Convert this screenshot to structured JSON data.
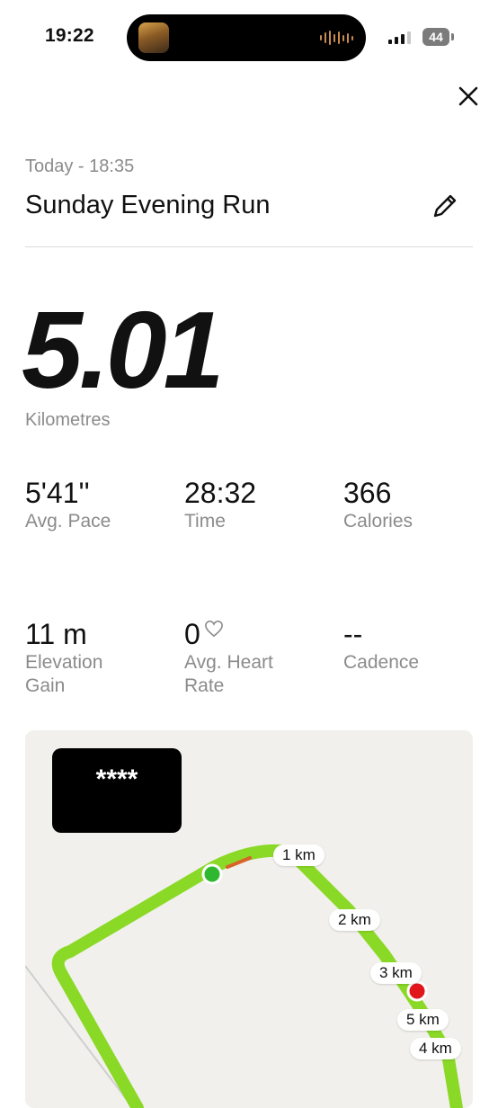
{
  "status_bar": {
    "time": "19:22",
    "battery": "44"
  },
  "activity": {
    "date_line": "Today - 18:35",
    "title": "Sunday Evening Run",
    "distance": "5.01",
    "distance_unit": "Kilometres"
  },
  "stats": [
    {
      "value": "5'41''",
      "label": "Avg. Pace"
    },
    {
      "value": "28:32",
      "label": "Time"
    },
    {
      "value": "366",
      "label": "Calories"
    },
    {
      "value": "11 m",
      "label": "Elevation Gain"
    },
    {
      "value": "0",
      "label": "Avg. Heart Rate"
    },
    {
      "value": "--",
      "label": "Cadence"
    }
  ],
  "map": {
    "privacy_label": "****",
    "km_markers": [
      "1 km",
      "2 km",
      "3 km",
      "5 km",
      "4 km"
    ],
    "route_color": "#8ad926",
    "start_color": "#2fb82f",
    "end_color": "#e0161b"
  },
  "icons": {
    "close": "close-icon",
    "edit": "pencil-icon",
    "heart": "heart-outline-icon"
  }
}
